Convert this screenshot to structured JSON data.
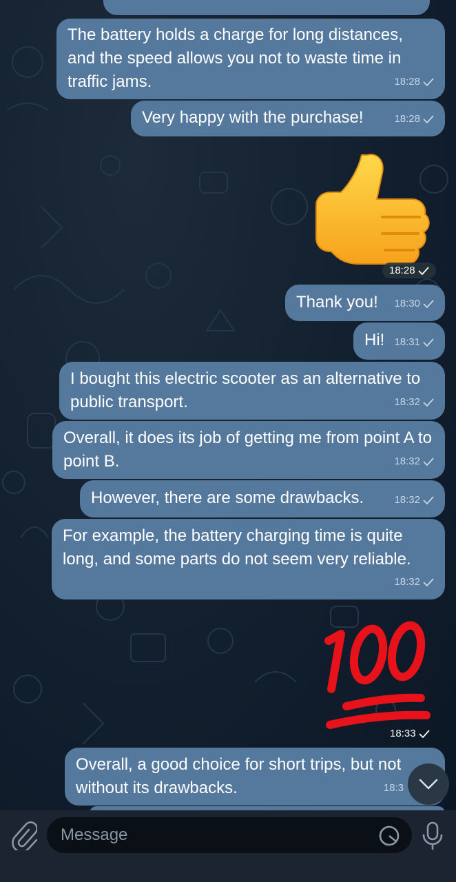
{
  "messages": [
    {
      "text": "The battery holds a charge for long distances, and the speed allows you not to waste time in traffic jams.",
      "time": "18:28"
    },
    {
      "text": "Very happy with the purchase!",
      "time": "18:28"
    },
    {
      "sticker": "thumbs-up",
      "time": "18:28"
    },
    {
      "text": "Thank you!",
      "time": "18:30"
    },
    {
      "text": "Hi!",
      "time": "18:31"
    },
    {
      "text": "I bought this electric scooter as an alternative to public transport.",
      "time": "18:32"
    },
    {
      "text": "Overall, it does its job of getting me from point A to point B.",
      "time": "18:32"
    },
    {
      "text": "However, there are some drawbacks.",
      "time": "18:32"
    },
    {
      "text": "For example, the battery charging time is quite long, and some parts do not seem very reliable.",
      "time": "18:32"
    },
    {
      "sticker": "hundred-points",
      "time": "18:33"
    },
    {
      "text": "Overall, a good choice for short trips, but not without its drawbacks.",
      "time": "18:3"
    }
  ],
  "input": {
    "placeholder": "Message"
  },
  "colors": {
    "bubble": "#55799c",
    "background": "#0e1b29",
    "input_bar": "#1b2430"
  }
}
